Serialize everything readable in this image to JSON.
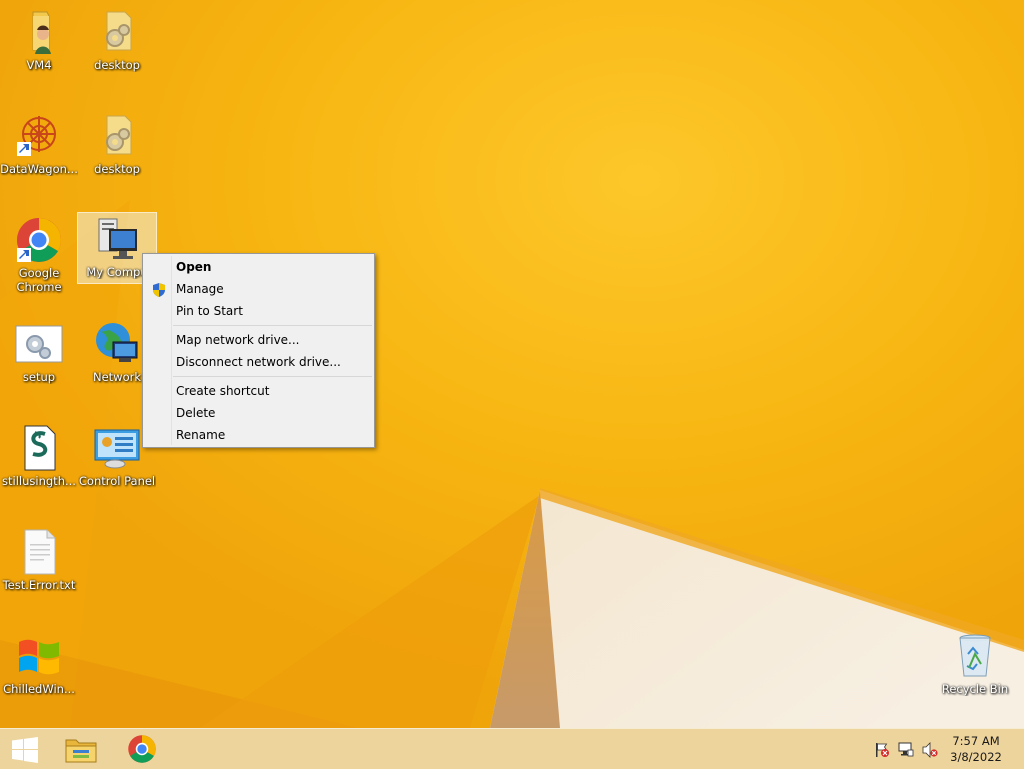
{
  "desktop": {
    "icons": [
      {
        "label": "VM4"
      },
      {
        "label": "desktop"
      },
      {
        "label": "DataWagon..."
      },
      {
        "label": "desktop"
      },
      {
        "label": "Google Chrome"
      },
      {
        "label": "My Compu"
      },
      {
        "label": "setup"
      },
      {
        "label": "Network"
      },
      {
        "label": "stillusingth..."
      },
      {
        "label": "Control Panel"
      },
      {
        "label": "Test.Error.txt"
      },
      {
        "label": "ChilledWin..."
      },
      {
        "label": "Recycle Bin"
      }
    ]
  },
  "context_menu": {
    "items": [
      {
        "label": "Open"
      },
      {
        "label": "Manage",
        "icon": "uac-shield-icon"
      },
      {
        "label": "Pin to Start"
      },
      {
        "label": "Map network drive..."
      },
      {
        "label": "Disconnect network drive..."
      },
      {
        "label": "Create shortcut"
      },
      {
        "label": "Delete"
      },
      {
        "label": "Rename"
      }
    ]
  },
  "taskbar": {
    "start_icon": "windows-logo-icon",
    "pinned": [
      {
        "icon": "file-explorer-icon"
      },
      {
        "icon": "chrome-icon"
      }
    ],
    "tray": {
      "icons": [
        "action-center-flag-icon",
        "network-icon",
        "volume-muted-icon"
      ],
      "time": "7:57 AM",
      "date": "3/8/2022"
    }
  },
  "colors": {
    "wallpaper": "#f6b60e",
    "taskbar": "#ecd6a8",
    "menu_bg": "#f0f0f0"
  }
}
